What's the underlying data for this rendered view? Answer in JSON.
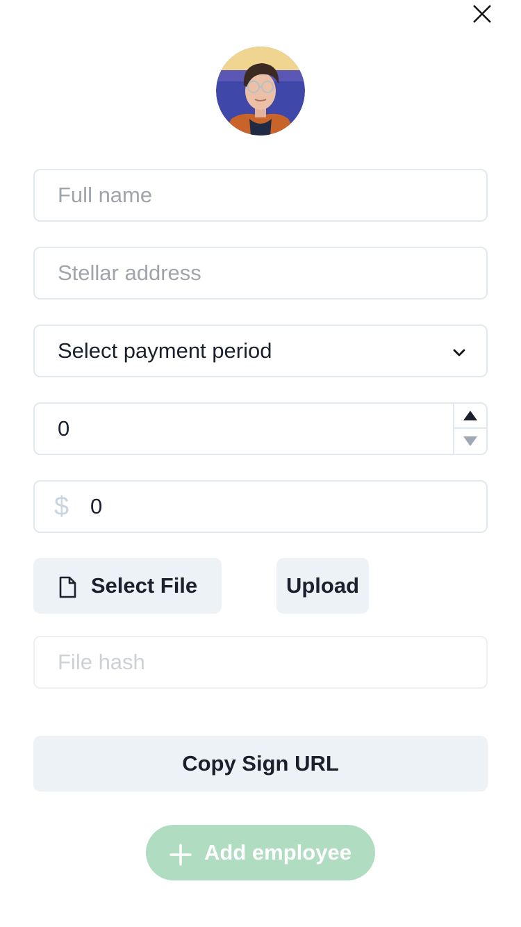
{
  "form": {
    "full_name_placeholder": "Full name",
    "stellar_address_placeholder": "Stellar address",
    "payment_period_selected": "Select payment period",
    "number_value": "0",
    "currency_symbol": "$",
    "amount_value": "0",
    "select_file_label": "Select File",
    "upload_label": "Upload",
    "file_hash_placeholder": "File hash",
    "copy_sign_url_label": "Copy Sign URL",
    "add_employee_label": "Add employee"
  },
  "icons": {
    "close": "close-icon",
    "avatar": "avatar",
    "select_chevron": "chevron-down-icon",
    "step_up": "triangle-up-icon",
    "step_down": "triangle-down-icon",
    "file": "file-icon",
    "plus": "plus-icon"
  },
  "colors": {
    "add_button_bg": "#b0dcc2",
    "secondary_button_bg": "#edf2f7",
    "border": "#e2e8f0",
    "currency_symbol": "#cbd5e0"
  }
}
